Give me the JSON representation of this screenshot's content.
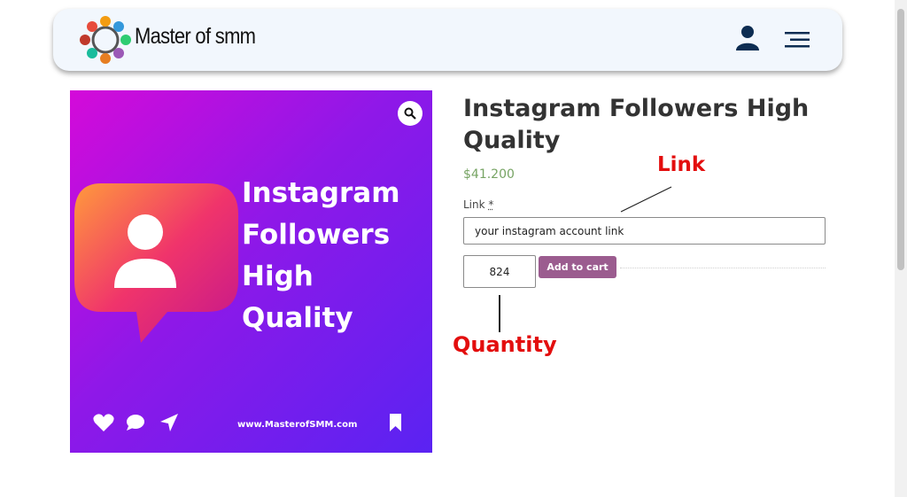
{
  "header": {
    "logo_text": "Master of smm",
    "account_icon": "user-icon",
    "menu_icon": "hamburger-menu-icon"
  },
  "product_image": {
    "zoom_icon": "magnifier-icon",
    "promo_lines": [
      "Instagram",
      "Followers",
      "High",
      "Quality"
    ],
    "website": "www.MasterofSMM.com",
    "icons": [
      "heart-icon",
      "comment-icon",
      "send-icon",
      "bookmark-icon"
    ],
    "gradient_colors": [
      "#d40ad9",
      "#5a23f2"
    ]
  },
  "product": {
    "title": "Instagram Followers High Quality",
    "price": "$41.200",
    "link_label": "Link",
    "required_mark": "*",
    "link_value": "your instagram account link",
    "quantity": "824",
    "add_to_cart": "Add to cart"
  },
  "annotations": {
    "link": "Link",
    "quantity": "Quantity"
  },
  "colors": {
    "price": "#77a464",
    "button": "#9b5c8f",
    "annotation": "#e30e0e"
  }
}
